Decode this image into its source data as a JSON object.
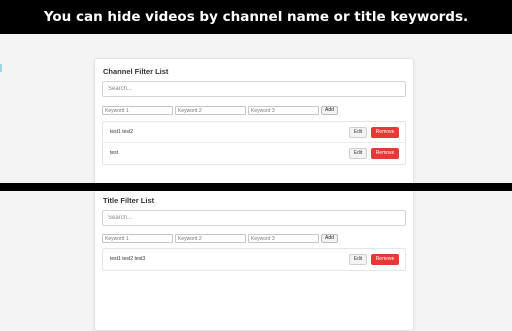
{
  "banner": {
    "text": "You can hide videos by channel name or title keywords."
  },
  "channel_panel": {
    "title": "Channel Filter List",
    "search_placeholder": "Search...",
    "keyword_placeholders": [
      "Keyword 1",
      "Keyword 2",
      "Keyword 3"
    ],
    "add_label": "Add",
    "items": [
      {
        "label": "test1 test2",
        "edit_label": "Edit",
        "remove_label": "Remove"
      },
      {
        "label": "test",
        "edit_label": "Edit",
        "remove_label": "Remove"
      }
    ]
  },
  "title_panel": {
    "title": "Title Filter List",
    "search_placeholder": "Search...",
    "keyword_placeholders": [
      "Keyword 1",
      "Keyword 2",
      "Keyword 3"
    ],
    "add_label": "Add",
    "items": [
      {
        "label": "test1 test2 test3",
        "edit_label": "Edit",
        "remove_label": "Remove"
      }
    ]
  },
  "colors": {
    "banner_bg": "#000000",
    "banner_text": "#ffffff",
    "remove_button": "#e53935",
    "page_bg": "#f4f4f4"
  }
}
